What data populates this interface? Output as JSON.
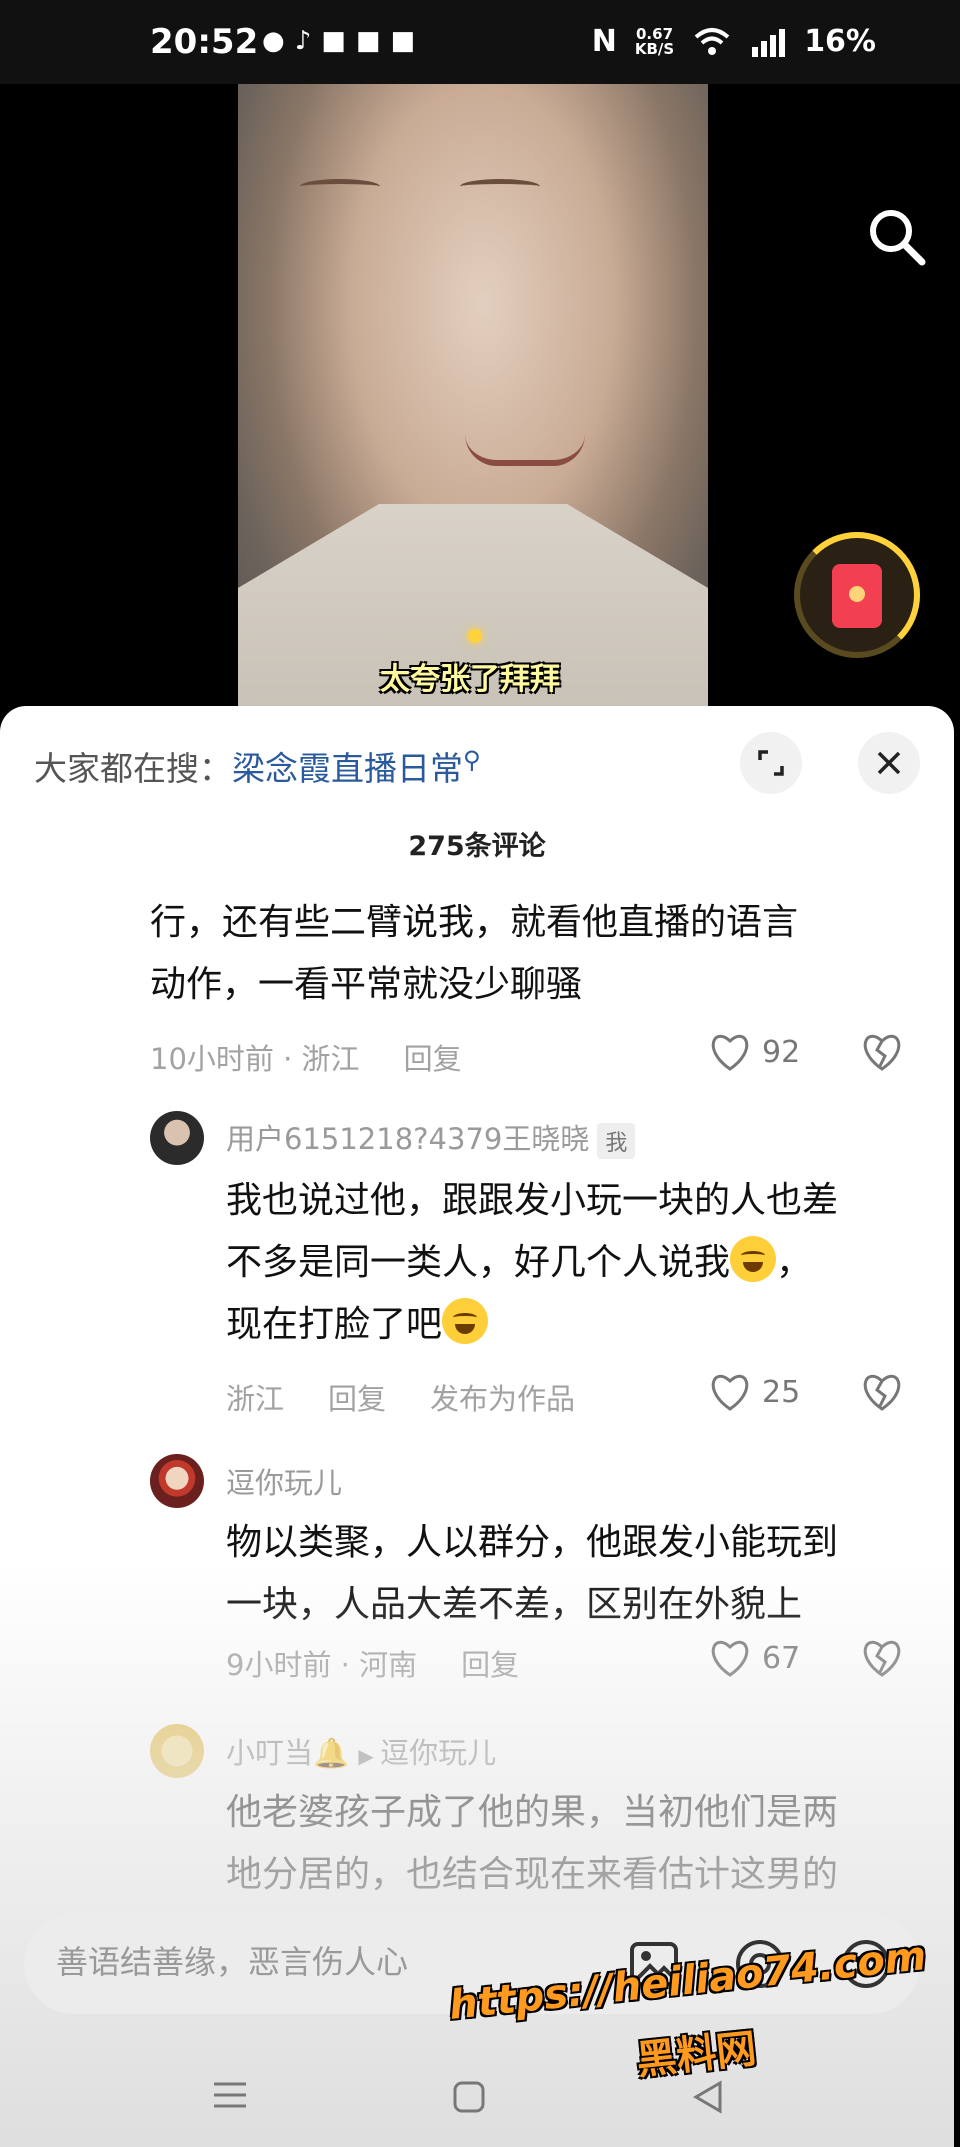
{
  "status_bar": {
    "time": "20:52",
    "net_speed_value": "0.67",
    "net_speed_unit": "KB/S",
    "signal": "5G",
    "battery": "16%"
  },
  "video": {
    "caption": "太夸张了拜拜"
  },
  "panel": {
    "hot_prefix": "大家都在搜：",
    "hot_keyword": "梁念霞直播日常",
    "comment_count": "275条评论"
  },
  "comments": [
    {
      "text_line1": "行，还有些二臂说我，就看他直播的语言",
      "text_line2": "动作，一看平常就没少聊骚",
      "time_location": "10小时前 · 浙江",
      "reply": "回复",
      "likes": "92"
    },
    {
      "user": "用户6151218?4379王晓晓",
      "tag": "我",
      "text_line1": "我也说过他，跟跟发小玩一块的人也差",
      "text_line2a": "不多是同一类人，好几个人说我",
      "text_line2b": "，",
      "text_line3": "现在打脸了吧",
      "location": "浙江",
      "reply": "回复",
      "publish": "发布为作品",
      "likes": "25"
    },
    {
      "user": "逗你玩儿",
      "text_line1": "物以类聚，人以群分，他跟发小能玩到",
      "text_line2": "一块，人品大差不差，区别在外貌上",
      "time_location": "9小时前 · 河南",
      "reply": "回复",
      "likes": "67"
    },
    {
      "user": "小叮当",
      "reply_to": "逗你玩儿",
      "text_line1": "他老婆孩子成了他的果，当初他们是两",
      "text_line2": "地分居的，也结合现在来看估计这男的"
    }
  ],
  "input": {
    "placeholder": "善语结善缘，恶言伤人心"
  },
  "watermark": {
    "url": "https://heiliao74.com",
    "name": "黑料网"
  },
  "icons": {
    "search": "search-icon",
    "red_packet": "red-packet-icon",
    "expand": "expand-icon",
    "close": "close-icon",
    "heart": "heart-icon",
    "dislike": "dislike-icon",
    "image": "image-icon",
    "at": "at-icon",
    "emoji": "emoji-icon"
  },
  "colors": {
    "keyword": "#2a5a9c",
    "watermark": "#ff9a1f",
    "panel_bg": "#ffffff"
  }
}
